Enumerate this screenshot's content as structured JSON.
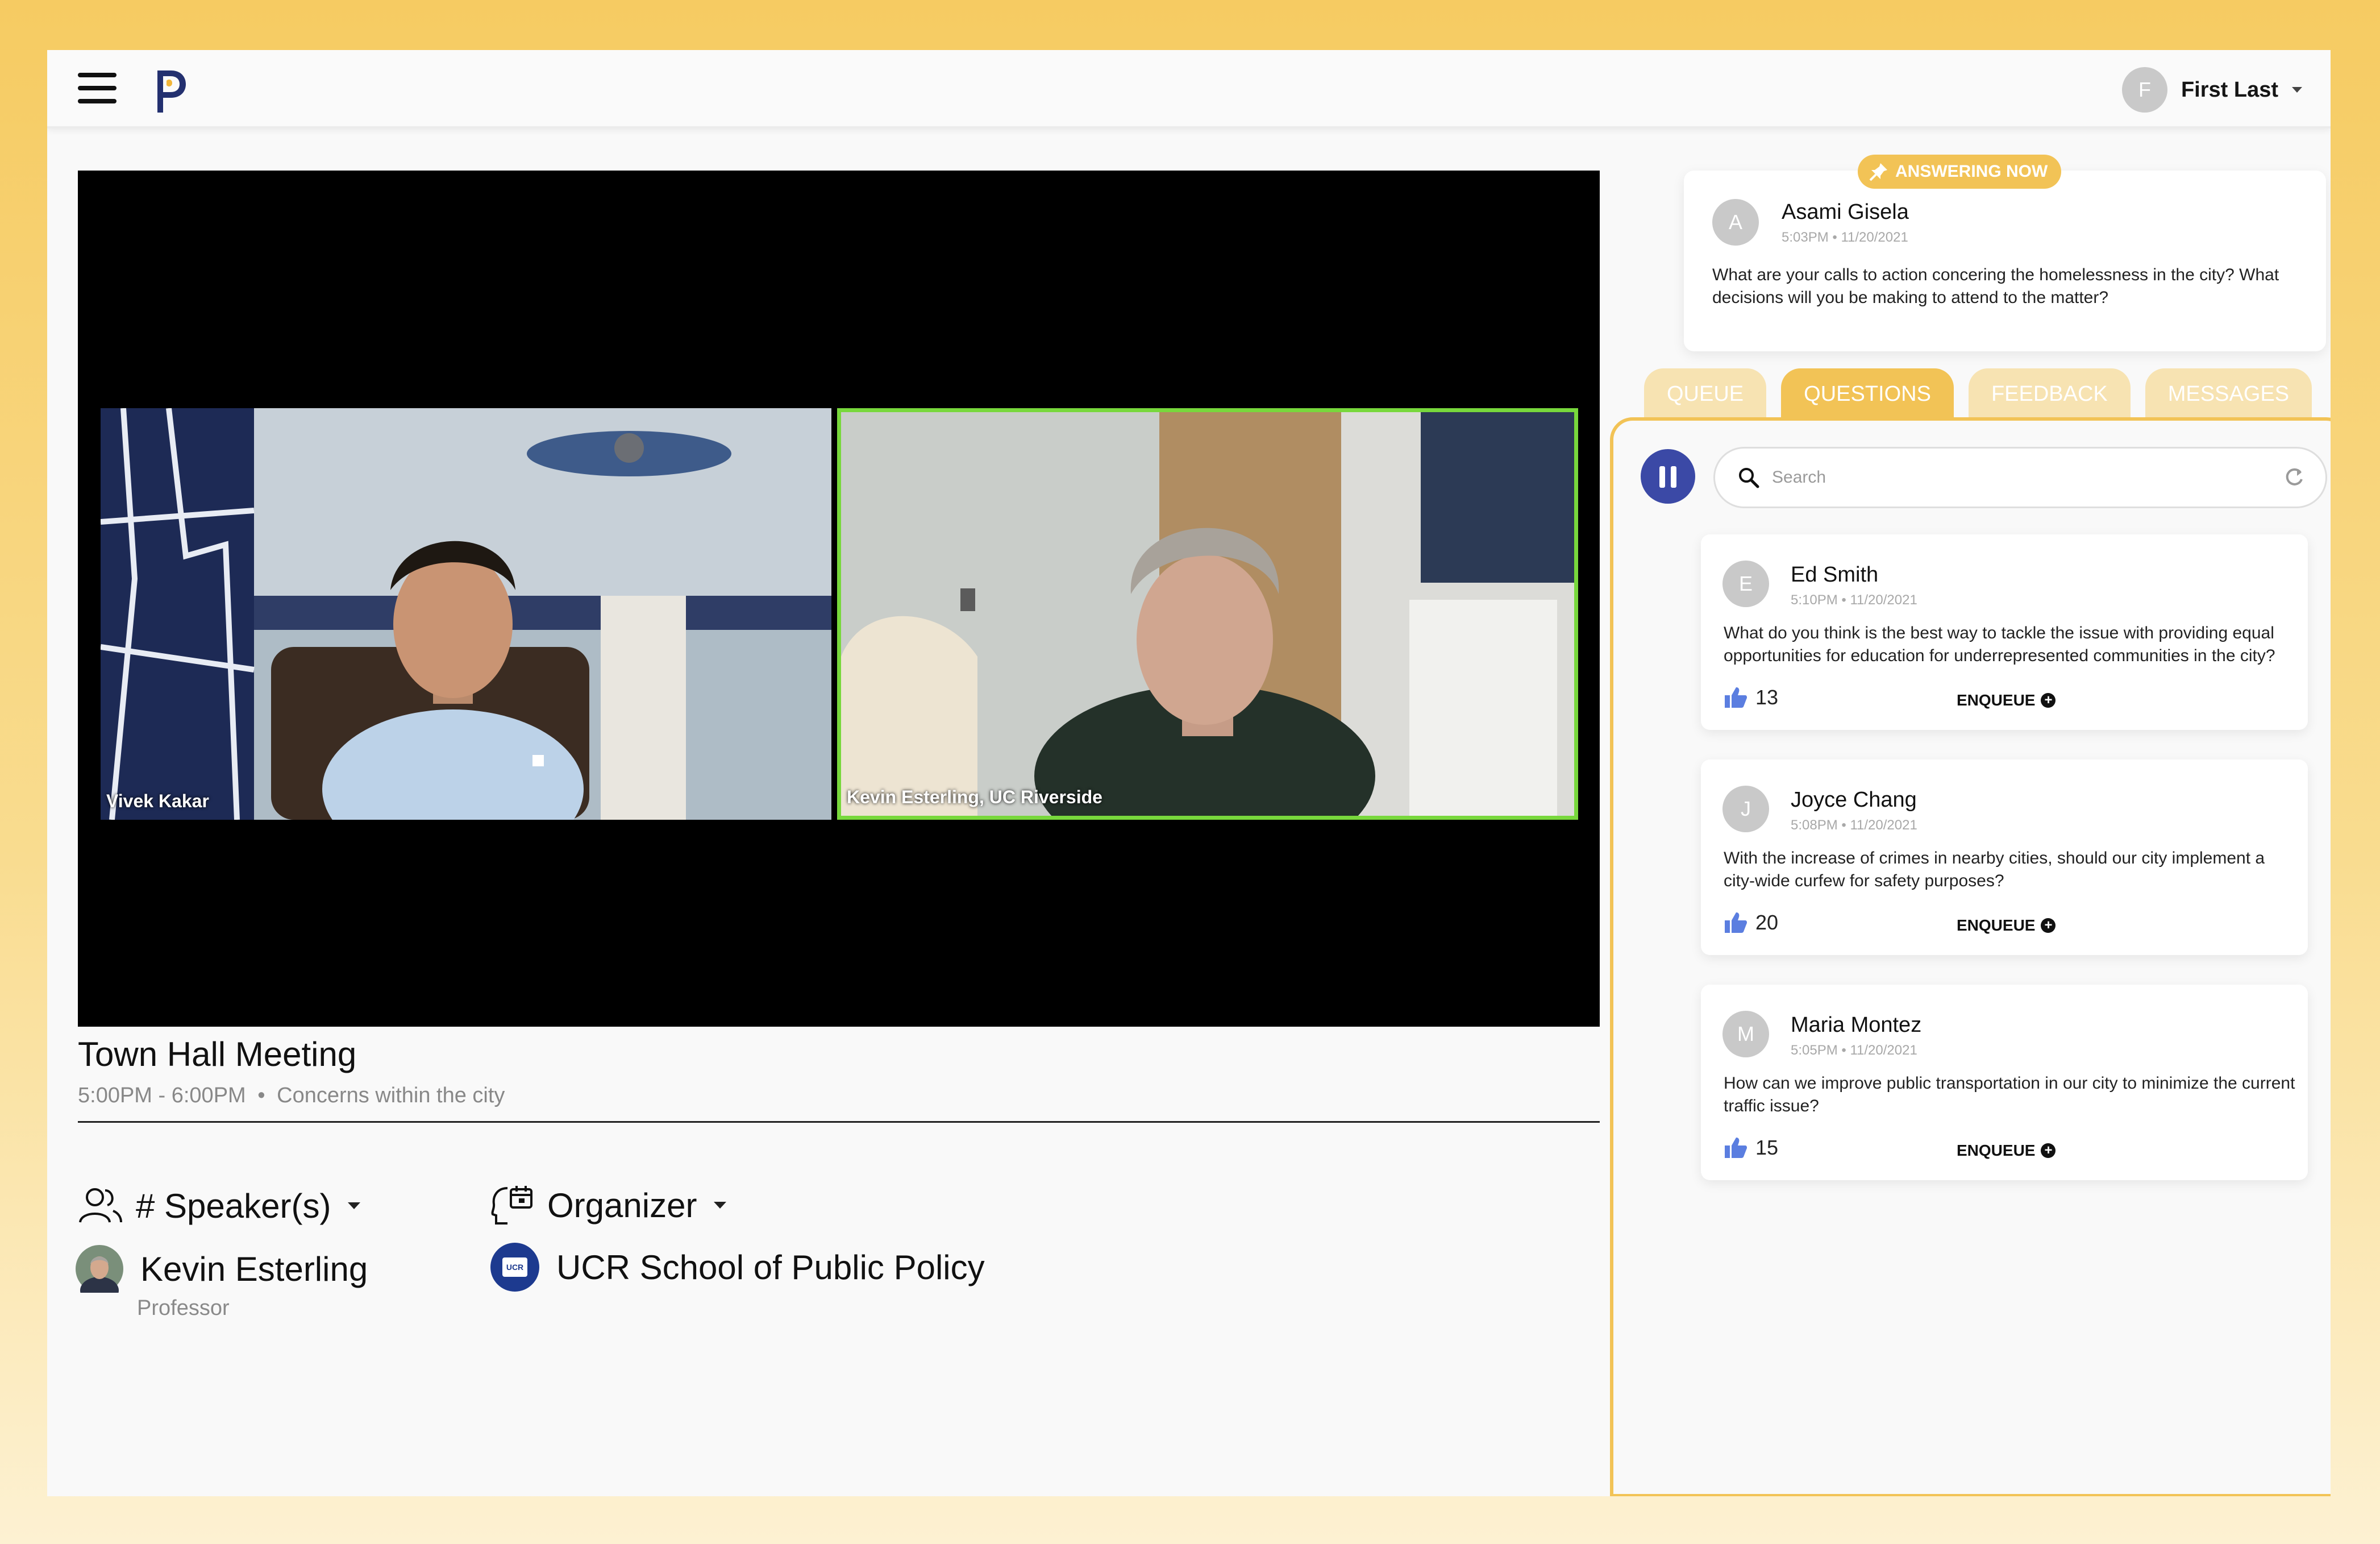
{
  "header": {
    "user": {
      "initial": "F",
      "name": "First Last"
    }
  },
  "video": {
    "participants": [
      {
        "label": "Vivek Kakar"
      },
      {
        "label": "Kevin Esterling, UC Riverside"
      }
    ]
  },
  "meeting": {
    "title": "Town Hall Meeting",
    "time": "5:00PM - 6:00PM",
    "separator": "•",
    "topic": "Concerns within the city"
  },
  "speakers": {
    "heading": "# Speaker(s)",
    "name": "Kevin Esterling",
    "role": "Professor"
  },
  "organizer": {
    "heading": "Organizer",
    "name": "UCR School of Public Policy",
    "logo_text": "UCR"
  },
  "answering_now": {
    "badge": "ANSWERING NOW",
    "initial": "A",
    "name": "Asami Gisela",
    "time": "5:03PM • 11/20/2021",
    "text": "What are your calls to action concering the homelessness in the city? What decisions will you be making to attend to the matter?"
  },
  "tabs": [
    {
      "label": "QUEUE",
      "active": false
    },
    {
      "label": "QUESTIONS",
      "active": true
    },
    {
      "label": "FEEDBACK",
      "active": false
    },
    {
      "label": "MESSAGES",
      "active": false
    }
  ],
  "search": {
    "placeholder": "Search"
  },
  "questions": [
    {
      "initial": "E",
      "name": "Ed Smith",
      "time": "5:10PM • 11/20/2021",
      "text": "What do you think is the best way to tackle the issue with providing equal opportunities for education for underrepresented communities in the city?",
      "likes": "13",
      "action": "ENQUEUE"
    },
    {
      "initial": "J",
      "name": "Joyce Chang",
      "time": "5:08PM • 11/20/2021",
      "text": "With the increase of crimes in nearby cities, should our city implement a city-wide curfew for safety purposes?",
      "likes": "20",
      "action": "ENQUEUE"
    },
    {
      "initial": "M",
      "name": "Maria Montez",
      "time": "5:05PM • 11/20/2021",
      "text": "How can we improve public transportation in our city to minimize the current traffic issue?",
      "likes": "15",
      "action": "ENQUEUE"
    }
  ],
  "colors": {
    "accent": "#f2c356",
    "accent_light": "#f7e3b2",
    "primary": "#3b49a6",
    "active_speaker": "#78d83c",
    "like": "#5b7ee0"
  }
}
